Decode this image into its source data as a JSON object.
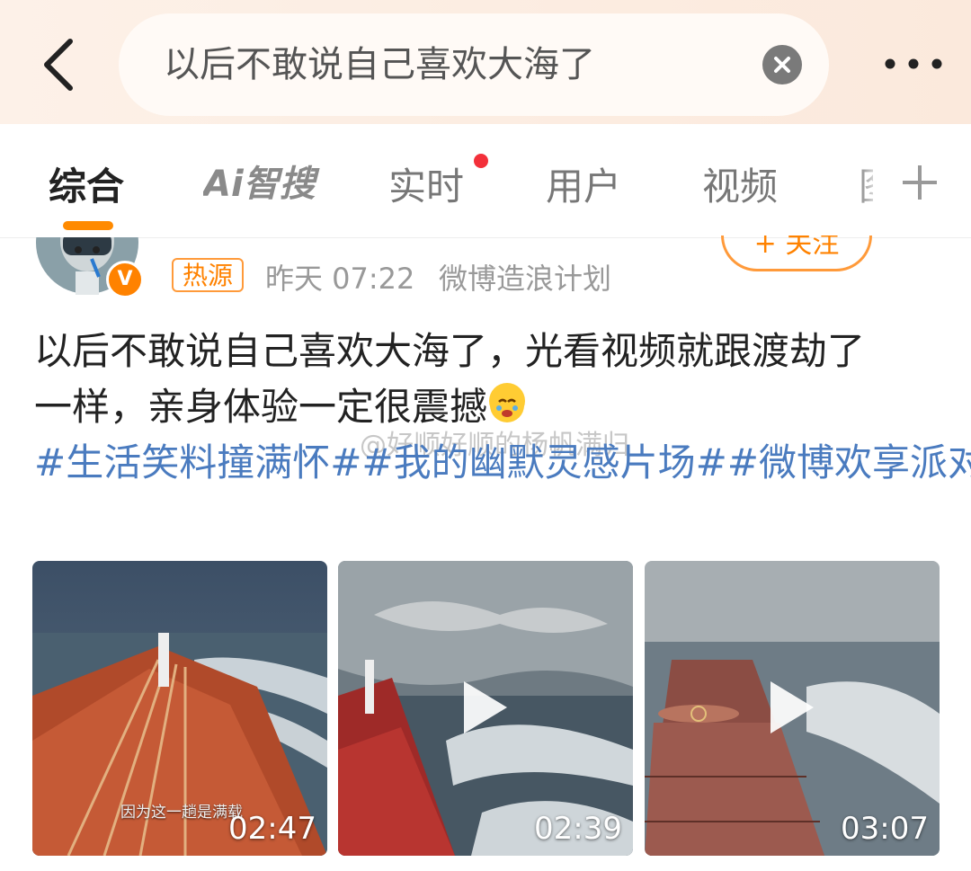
{
  "search": {
    "query": "以后不敢说自己喜欢大海了"
  },
  "tabs": [
    {
      "label": "综合",
      "active": true
    },
    {
      "label": "AI智搜",
      "logo_text": "Ai智搜"
    },
    {
      "label": "实时",
      "has_red_dot": true
    },
    {
      "label": "用户"
    },
    {
      "label": "视频"
    },
    {
      "label": "图"
    }
  ],
  "post": {
    "hot_badge": "热源",
    "time": "昨天 07:22",
    "source": "微博造浪计划",
    "follow_label": "+ 关注",
    "verified_mark": "V",
    "text_line1": "以后不敢说自己喜欢大海了，光看视频就跟渡劫了",
    "text_line2": "一样，亲身体验一定很震撼",
    "emoji": "crying-face-emoji",
    "watermark": "@好顺好顺的杨帆满归",
    "hashtags": [
      "#生活笑料撞满怀#",
      "#我的幽默灵感片场#",
      "#微博欢享派对#"
    ]
  },
  "videos": [
    {
      "duration": "02:47",
      "caption": "因为这一趟是满载",
      "show_play": false
    },
    {
      "duration": "02:39",
      "caption": "",
      "show_play": true
    },
    {
      "duration": "03:07",
      "caption": "",
      "show_play": true
    }
  ],
  "colors": {
    "accent": "#ff8200",
    "hashtag": "#4a7bbf",
    "red_dot": "#f3303a"
  }
}
